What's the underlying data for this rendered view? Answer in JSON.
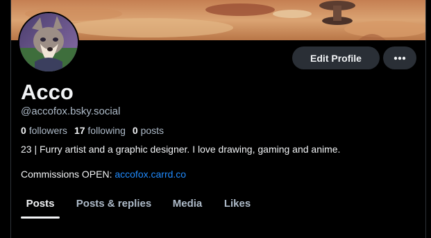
{
  "profile": {
    "display_name": "Acco",
    "handle": "@accofox.bsky.social",
    "followers_count": "0",
    "followers_label": "followers",
    "following_count": "17",
    "following_label": "following",
    "posts_count": "0",
    "posts_label": "posts",
    "bio": "23 | Furry artist and a graphic designer. I love drawing, gaming and anime.",
    "commissions_text": "Commissions OPEN: ",
    "commissions_link": "accofox.carrd.co"
  },
  "actions": {
    "edit_profile_label": "Edit Profile",
    "more_icon": "ellipsis-icon"
  },
  "tabs": [
    {
      "label": "Posts",
      "active": true
    },
    {
      "label": "Posts & replies",
      "active": false
    },
    {
      "label": "Media",
      "active": false
    },
    {
      "label": "Likes",
      "active": false
    }
  ],
  "colors": {
    "background": "#000000",
    "text_primary": "#f1f3f5",
    "text_secondary": "#aebbc9",
    "link": "#208bfe",
    "button_bg": "#2a2f36"
  }
}
